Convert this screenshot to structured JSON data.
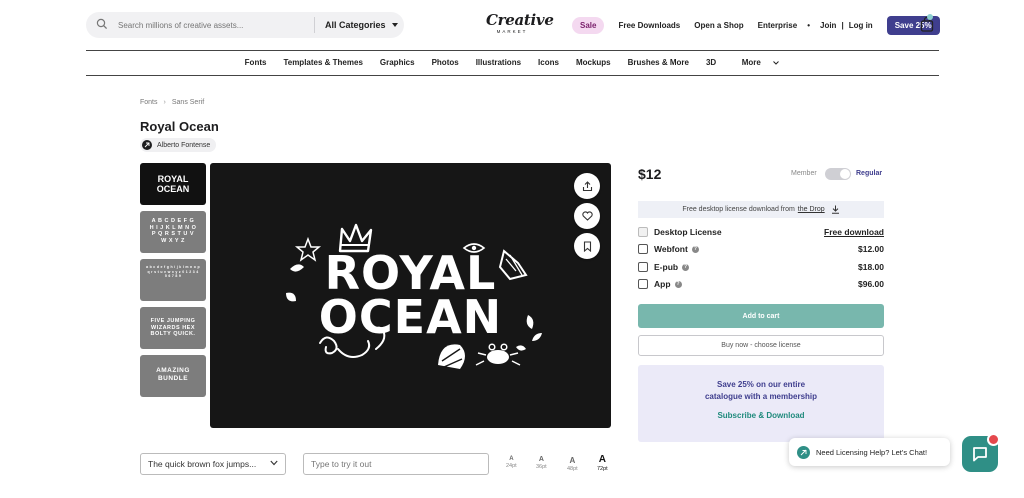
{
  "header": {
    "search_placeholder": "Search millions of creative assets...",
    "categories_label": "All Categories",
    "logo_line1": "Creative",
    "logo_line2": "MARKET",
    "sale": "Sale",
    "free_downloads": "Free Downloads",
    "open_shop": "Open a Shop",
    "enterprise": "Enterprise",
    "bullet": "•",
    "join": "Join",
    "separator": "|",
    "login": "Log in",
    "save_button": "Save 25%"
  },
  "category_nav": [
    "Fonts",
    "Templates & Themes",
    "Graphics",
    "Photos",
    "Illustrations",
    "Icons",
    "Mockups",
    "Brushes & More",
    "3D"
  ],
  "more_label": "More",
  "breadcrumb": {
    "level1": "Fonts",
    "chevron": "›",
    "level2": "Sans Serif"
  },
  "product": {
    "title": "Royal Ocean",
    "author": "Alberto Fontense",
    "preview_line1": "ROYAL",
    "preview_line2": "OCEAN"
  },
  "thumbnails": [
    {
      "text": "ROYAL OCEAN"
    },
    {
      "text": "A B C D E F G H I J K L M N O P Q R S T U V W X Y Z"
    },
    {
      "text": "a b c d e f g h i j k l m n o p q r s t u v w x y z 0 1 2 3 4 5 6 7 8 9"
    },
    {
      "text": "FIVE JUMPING WIZARDS HEX BOLTY QUICK."
    },
    {
      "text": "AMAZING BUNDLE"
    }
  ],
  "tester": {
    "sample_text": "The quick brown fox jumps...",
    "try_placeholder": "Type to try it out",
    "sizes": [
      {
        "glyph": "A",
        "label": "24pt"
      },
      {
        "glyph": "A",
        "label": "36pt"
      },
      {
        "glyph": "A",
        "label": "48pt"
      },
      {
        "glyph": "A",
        "label": "72pt",
        "selected": true
      }
    ]
  },
  "purchase": {
    "price": "$12",
    "member_label": "Member",
    "regular_label": "Regular",
    "free_banner_text": "Free desktop license download from",
    "free_banner_link": "the Drop",
    "licenses": [
      {
        "name": "Desktop License",
        "price": "Free download",
        "disabled": true
      },
      {
        "name": "Webfont",
        "price": "$12.00",
        "info": true
      },
      {
        "name": "E-pub",
        "price": "$18.00",
        "info": true
      },
      {
        "name": "App",
        "price": "$96.00",
        "info": true
      }
    ],
    "add_to_cart": "Add to cart",
    "buy_now": "Buy now - choose license",
    "promo_line1": "Save 25% on our entire",
    "promo_line2": "catalogue with a membership",
    "promo_link": "Subscribe & Download"
  },
  "chat": {
    "label": "Need Licensing Help? Let's Chat!"
  },
  "colors": {
    "brand_purple": "#3f3e8e",
    "teal": "#2f8f86",
    "add_cart": "#78b7ad",
    "sale_pink": "#f4d9f0"
  }
}
